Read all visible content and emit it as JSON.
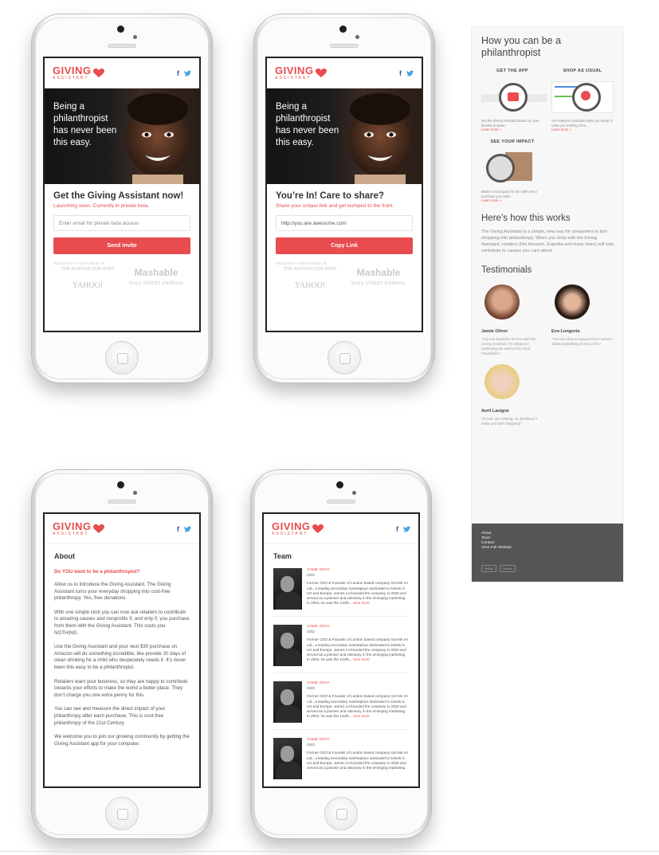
{
  "brand": {
    "name": "GIVING",
    "subname": "ASSISTANT",
    "color": "#e84c4f",
    "facebook_icon": "f"
  },
  "hero": {
    "headline": "Being a philanthropist has never been this easy."
  },
  "phone1": {
    "heading": "Get the Giving Assistant now!",
    "subheading": "Launching soon. Currently in private beta.",
    "input_placeholder": "Enter email for private beta access",
    "button": "Send invite"
  },
  "phone2": {
    "heading": "You’re In! Care to share?",
    "subheading": "Share your unique link and get bumped to the front.",
    "input_value": "http://you.are.awesome.com",
    "button": "Copy Link"
  },
  "press": {
    "label": "RECENTLY FEATURED IN",
    "huffington": "THE HUFFINGTON POST",
    "mashable": "Mashable",
    "yahoo": "YAHOO!",
    "wsj": "WALL STREET JOURNAL"
  },
  "about": {
    "title": "About",
    "question": "Do YOU want to be a philanthropist?",
    "paragraphs": [
      "Allow us to introduce the Giving Assistant. The Giving Assistant turns your everyday shopping into cost-free philanthropy. Yes, free donations.",
      "With one simple click you can now ask retailers to contribute to amazing causes and nonprofits if, and only if, you purchase from them with the Giving Assistant. This costs you NOTHING.",
      "Use the Giving Assistant and your next $30 purchase on Amazon will do something incredible, like provide 30 days of clean drinking for a child who desperately needs it. It’s never been this easy to be a philanthropist.",
      "Retailers want your business, so they are happy to contribute towards your efforts to make the world a better place. They don’t charge you one extra penny for this.",
      "You can see and measure the direct impact of your philanthropy after each purchase. This is cost-free philanthropy of the 21st Century.",
      "We welcome you to join our growing community by getting the Giving Assistant app for your computer."
    ]
  },
  "team": {
    "title": "Team",
    "members": [
      {
        "name": "JAMIE GRAY",
        "role": "CEO",
        "bio": "Former CEO & Founder of London based company Get Me In! Ltd., a leading secondary marketplace dedicated to tickets in UK and Europe. James co-founded the company in 2003 and served as a pioneer and visionary in the emerging marketing. In 2004, he was the 134th...",
        "more": "view more"
      },
      {
        "name": "JAMIE GRAY",
        "role": "CEO",
        "bio": "Former CEO & Founder of London based company Get Me In! Ltd., a leading secondary marketplace dedicated to tickets in UK and Europe. James co-founded the company in 2003 and served as a pioneer and visionary in the emerging marketing. In 2004, he was the 134th...",
        "more": "view more"
      },
      {
        "name": "JAMIE GRAY",
        "role": "CEO",
        "bio": "Former CEO & Founder of London based company Get Me In! Ltd., a leading secondary marketplace dedicated to tickets in UK and Europe. James co-founded the company in 2003 and served as a pioneer and visionary in the emerging marketing. In 2004, he was the 134th...",
        "more": "view more"
      },
      {
        "name": "JAMIE GRAY",
        "role": "CEO",
        "bio": "Former CEO & Founder of London based company Get Me In! Ltd., a leading secondary marketplace dedicated to tickets in UK and Europe. James co-founded the company in 2003 and served as a pioneer and visionary in the emerging marketing.",
        "more": ""
      }
    ]
  },
  "desktop": {
    "title": "How you can be a philanthropist",
    "steps": [
      {
        "title": "GET THE APP",
        "text": "Get the Giving Assistant button on your favorite browser.",
        "learn": "Learn more »"
      },
      {
        "title": "SHOP AS USUAL",
        "text": "Our retailers contribute when you shop. It costs you nothing extra.",
        "learn": "Learn more »"
      },
      {
        "title": "SEE YOUR IMPACT",
        "text": "Make a real impact for free with every purchase you make.",
        "learn": "Learn more »"
      }
    ],
    "how_title": "Here’s how this works",
    "how_body": "The Giving Assistant is a simple, new way for consumers to turn shopping into philanthropy. When you shop with the Giving Assistant, retailers (like Amazon, Expedia and many more) will now contribute to causes you care about.",
    "testimonials_title": "Testimonials",
    "testimonials": [
      {
        "name": "Jamie Oliver",
        "quote": "“You can fundraise for free with the Giving Assistant. It’s integral in continuing the work of the Food Foundation.”"
      },
      {
        "name": "Eva Longoria",
        "quote": "“You can shop to support Eva’s Heroes without spending an extra cent.”"
      },
      {
        "name": "Avril Lavigne",
        "quote": "“It costs you nothing, so download it today and start shopping!”"
      }
    ],
    "footer_links": [
      "About",
      "Team",
      "Contact",
      "View Full Website"
    ],
    "badges": [
      "Mobile",
      "Secure"
    ]
  }
}
